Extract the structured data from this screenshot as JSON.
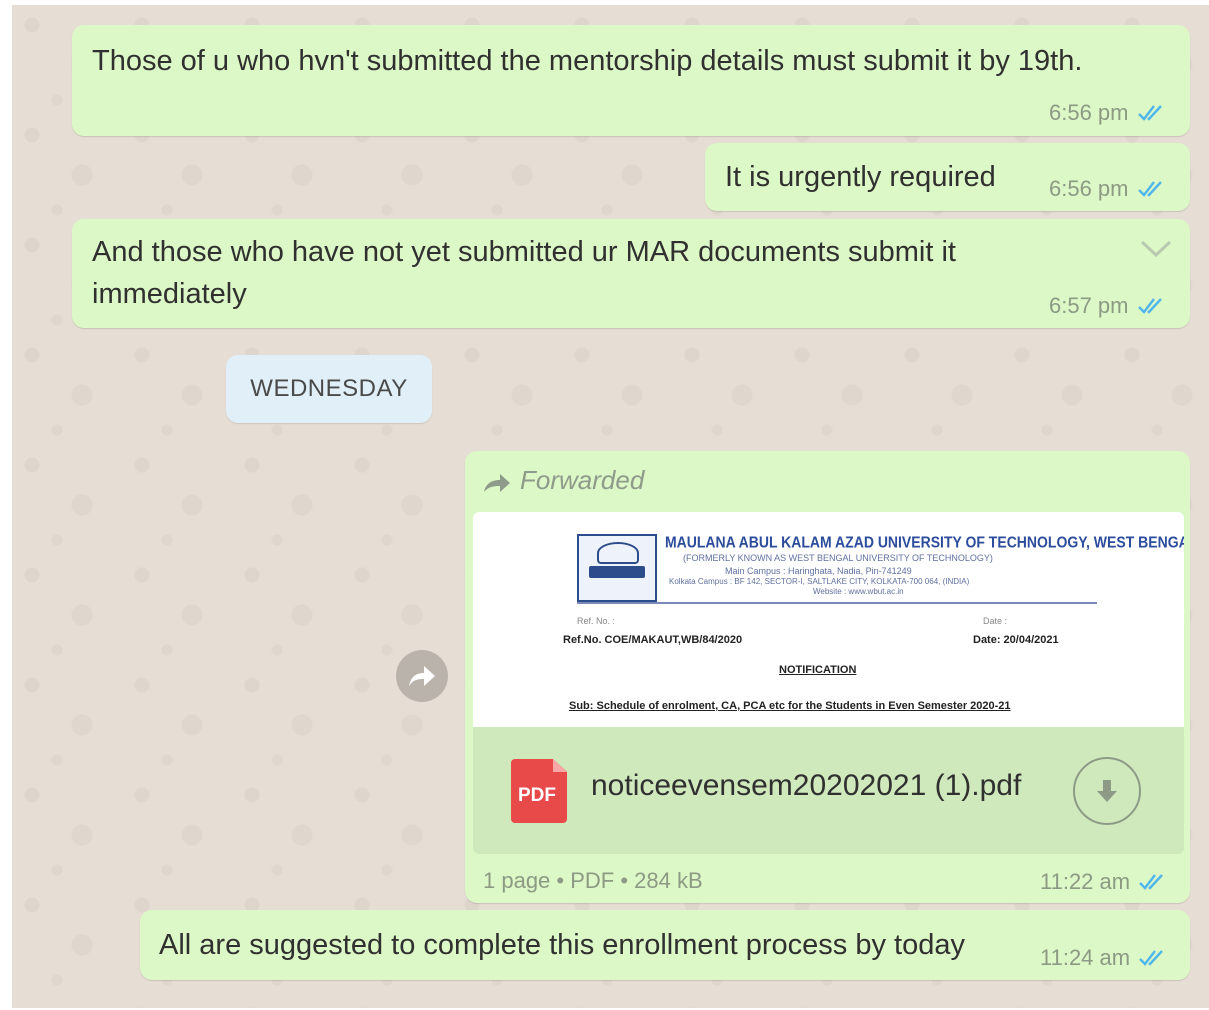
{
  "messages": [
    {
      "text": "Those of u who hvn't submitted the mentorship details must submit it by 19th.",
      "time": "6:56 pm"
    },
    {
      "text": "It is urgently required",
      "time": "6:56 pm"
    },
    {
      "text_line1": "And those who have not yet submitted ur MAR documents submit it",
      "text_line2": "immediately",
      "time": "6:57 pm"
    }
  ],
  "date_divider": "WEDNESDAY",
  "forwarded_message": {
    "forwarded_label": "Forwarded",
    "preview": {
      "university": "MAULANA ABUL KALAM AZAD UNIVERSITY OF TECHNOLOGY, WEST BENGAL",
      "formerly": "(FORMERLY KNOWN AS WEST BENGAL UNIVERSITY OF TECHNOLOGY)",
      "campus": "Main Campus : Haringhata, Nadia, Pin-741249",
      "kolkata_campus": "Kolkata Campus : BF 142, SECTOR-I, SALTLAKE CITY, KOLKATA-700 064, (INDIA)",
      "website": "Website : www.wbut.ac.in",
      "ref_no_label": "Ref. No. :",
      "date_label": "Date :",
      "ref_no": "Ref.No. COE/MAKAUT,WB/84/2020",
      "date": "Date: 20/04/2021",
      "notification": "NOTIFICATION",
      "subject": "Sub: Schedule of enrolment, CA, PCA etc for the Students in Even Semester 2020-21"
    },
    "file_icon_label": "PDF",
    "file_name": "noticeevensem20202021 (1).pdf",
    "file_meta": "1 page • PDF • 284 kB",
    "time": "11:22 am"
  },
  "last_message": {
    "text": "All are suggested to complete this enrollment process by today",
    "time": "11:24 am"
  },
  "icons": {
    "read_ticks": "double-check-icon",
    "forward": "forward-arrow-icon",
    "download": "download-icon",
    "menu": "chevron-down-icon"
  },
  "colors": {
    "outgoing_bubble": "#dcf8c6",
    "file_row": "#cfe9bc",
    "read_ticks": "#4fb6ec",
    "pdf_icon": "#e84a4a",
    "date_chip": "#e1f0f8"
  }
}
